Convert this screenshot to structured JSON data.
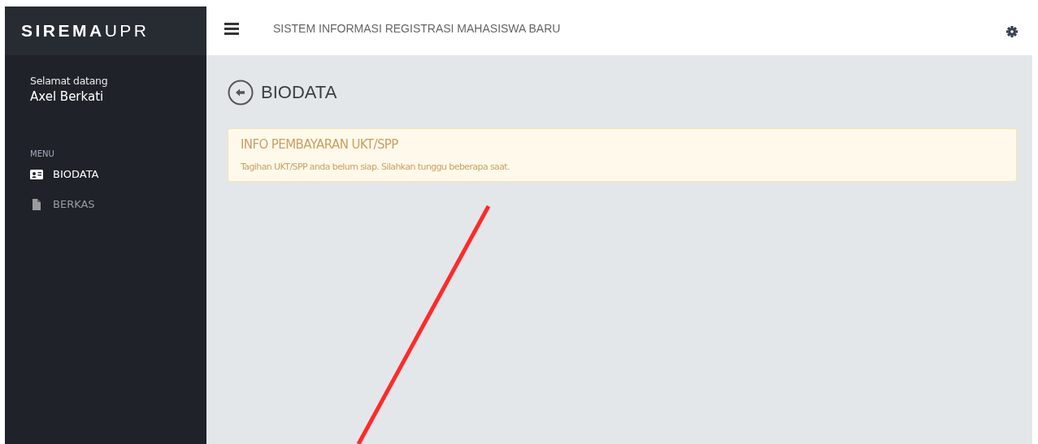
{
  "sidebar": {
    "logo": "**SIREMA**UPR",
    "greeting": "Selamat datang",
    "user_name": "Axel Berkati",
    "menu_heading": "MENU",
    "items": [
      {
        "label": "BIODATA",
        "kind": "id-card",
        "selected": true
      },
      {
        "label": "BERKAS",
        "kind": "file",
        "selected": false
      }
    ]
  },
  "header": {
    "title": "SISTEM INFORMASI REGISTRASI MAHASISWA BARU"
  },
  "page": {
    "title": "BIODATA",
    "alert": {
      "title": "INFO PEMBAYARAN UKT/SPP",
      "message": "Tagihan UKT/SPP anda belum siap. Silahkan tunggu beberapa saat."
    }
  }
}
